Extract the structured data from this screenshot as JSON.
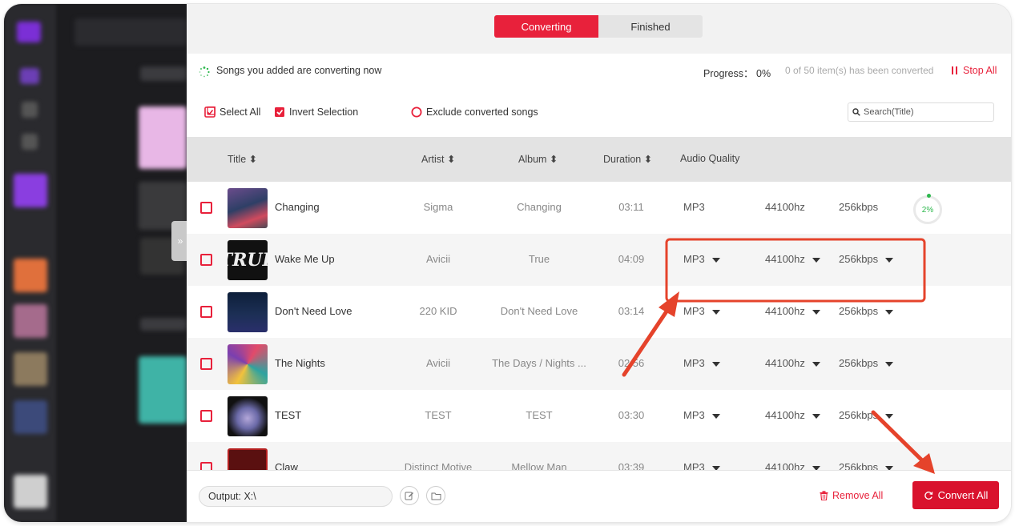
{
  "tabs": [
    {
      "label": "Converting",
      "active": true
    },
    {
      "label": "Finished",
      "active": false
    }
  ],
  "status": {
    "message": "Songs you added are converting now",
    "progress_label": "Progress： 0%",
    "progress_count": "0 of 50 item(s) has been converted",
    "stop_all": "Stop All"
  },
  "toolbar": {
    "select_all": "Select All",
    "invert_selection": "Invert Selection",
    "exclude_converted": "Exclude converted songs",
    "search_placeholder": "Search(Title)"
  },
  "columns": [
    "Title",
    "Artist",
    "Album",
    "Duration",
    "Audio Quality"
  ],
  "rows": [
    {
      "title": "Changing",
      "artist": "Sigma",
      "album": "Changing",
      "duration": "03:11",
      "format": "MP3",
      "sample_rate": "44100hz",
      "bitrate": "256kbps",
      "progress": "2%",
      "dropdowns": false
    },
    {
      "title": "Wake Me Up",
      "artist": "Avicii",
      "album": "True",
      "duration": "04:09",
      "format": "MP3",
      "sample_rate": "44100hz",
      "bitrate": "256kbps",
      "dropdowns": true
    },
    {
      "title": "Don't Need Love",
      "artist": "220 KID",
      "album": "Don't Need Love",
      "duration": "03:14",
      "format": "MP3",
      "sample_rate": "44100hz",
      "bitrate": "256kbps",
      "dropdowns": true
    },
    {
      "title": "The Nights",
      "artist": "Avicii",
      "album": "The Days / Nights ...",
      "duration": "02:56",
      "format": "MP3",
      "sample_rate": "44100hz",
      "bitrate": "256kbps",
      "dropdowns": true
    },
    {
      "title": "TEST",
      "artist": "TEST",
      "album": "TEST",
      "duration": "03:30",
      "format": "MP3",
      "sample_rate": "44100hz",
      "bitrate": "256kbps",
      "dropdowns": true
    },
    {
      "title": "Claw",
      "artist": "Distinct Motive",
      "album": "Mellow Man",
      "duration": "03:39",
      "format": "MP3",
      "sample_rate": "44100hz",
      "bitrate": "256kbps",
      "dropdowns": true
    }
  ],
  "footer": {
    "output": "Output: X:\\",
    "remove_all": "Remove All",
    "convert_all": "Convert All"
  },
  "colors": {
    "accent": "#e8213b",
    "convert_button": "#d9122d",
    "progress_green": "#2db84d",
    "annotation": "#e5432b"
  },
  "icons": [
    "spinner-icon",
    "pause-icon",
    "checkbox-icon",
    "radio-circle-icon",
    "search-icon",
    "sort-icon",
    "edit-icon",
    "folder-icon",
    "trash-icon",
    "refresh-icon",
    "expand-chevron-icon"
  ]
}
